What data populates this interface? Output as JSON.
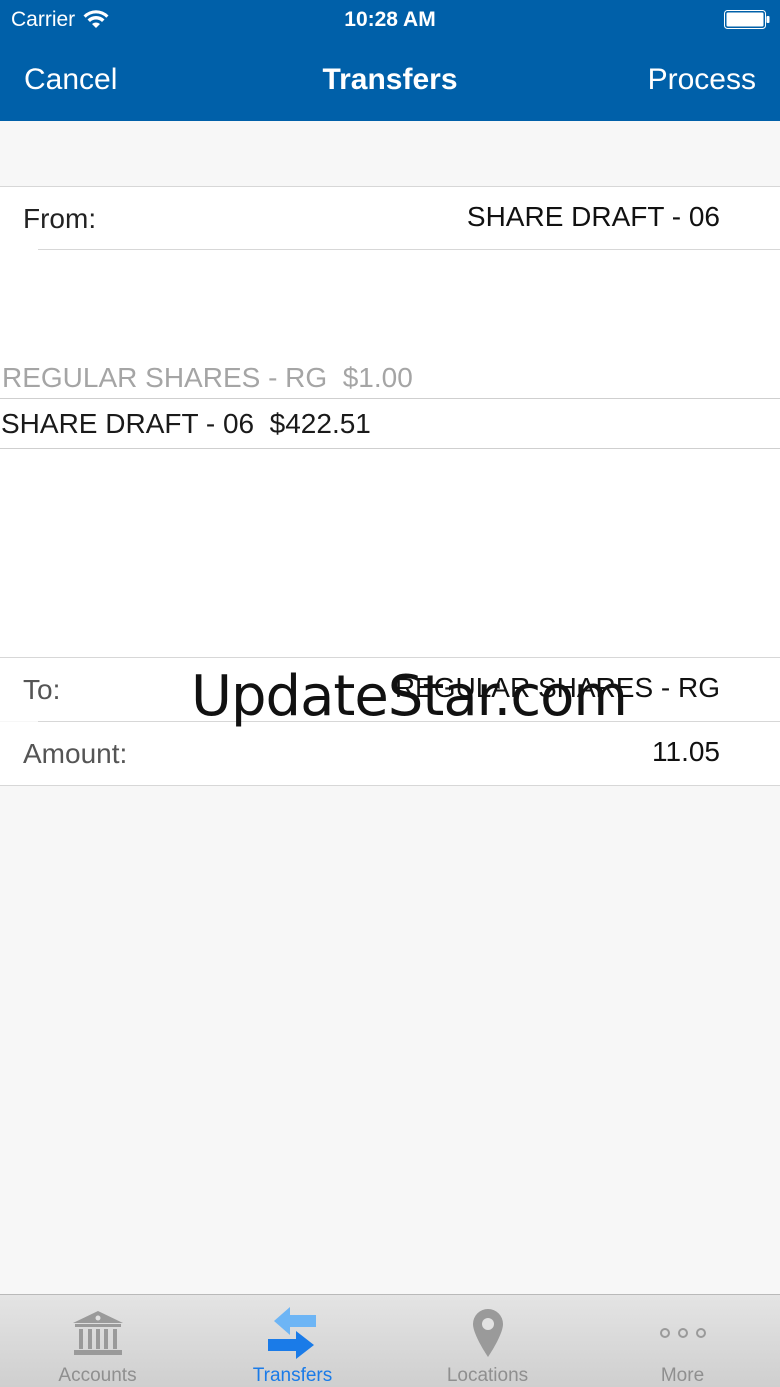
{
  "status_bar": {
    "carrier": "Carrier",
    "time": "10:28 AM",
    "wifi_icon": "wifi-icon",
    "battery_icon": "battery-icon"
  },
  "nav": {
    "cancel_label": "Cancel",
    "title": "Transfers",
    "process_label": "Process"
  },
  "form": {
    "from_label": "From:",
    "from_value": "SHARE DRAFT - 06",
    "to_label": "To:",
    "to_value": "REGULAR SHARES - RG",
    "amount_label": "Amount:",
    "amount_value": "11.05"
  },
  "picker": {
    "options": [
      {
        "label": "REGULAR SHARES - RG  $1.00",
        "selected": false
      },
      {
        "label": "SHARE DRAFT - 06  $422.51",
        "selected": true
      }
    ]
  },
  "watermark": "UpdateStar.com",
  "tabs": [
    {
      "label": "Accounts",
      "icon": "bank-icon",
      "active": false
    },
    {
      "label": "Transfers",
      "icon": "transfer-arrows-icon",
      "active": true
    },
    {
      "label": "Locations",
      "icon": "location-pin-icon",
      "active": false
    },
    {
      "label": "More",
      "icon": "more-dots-icon",
      "active": false
    }
  ],
  "colors": {
    "header_bg": "#0060a9",
    "active_tab": "#1a7be8",
    "inactive_tab": "#8f8f8f"
  }
}
